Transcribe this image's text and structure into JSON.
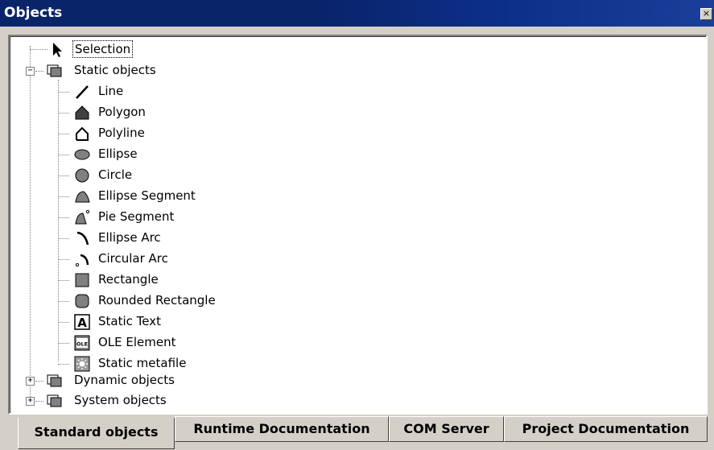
{
  "window": {
    "title": "Objects",
    "close_glyph": "×"
  },
  "tree": {
    "selection": "Selection",
    "static_group": "Static objects",
    "static_items": [
      {
        "label": "Line",
        "icon": "line-icon"
      },
      {
        "label": "Polygon",
        "icon": "polygon-icon"
      },
      {
        "label": "Polyline",
        "icon": "polyline-icon"
      },
      {
        "label": "Ellipse",
        "icon": "ellipse-icon"
      },
      {
        "label": "Circle",
        "icon": "circle-icon"
      },
      {
        "label": "Ellipse Segment",
        "icon": "ellipse-segment-icon"
      },
      {
        "label": "Pie Segment",
        "icon": "pie-segment-icon"
      },
      {
        "label": "Ellipse Arc",
        "icon": "ellipse-arc-icon"
      },
      {
        "label": "Circular Arc",
        "icon": "circular-arc-icon"
      },
      {
        "label": "Rectangle",
        "icon": "rectangle-icon"
      },
      {
        "label": "Rounded Rectangle",
        "icon": "rounded-rectangle-icon"
      },
      {
        "label": "Static Text",
        "icon": "static-text-icon"
      },
      {
        "label": "OLE Element",
        "icon": "ole-element-icon"
      },
      {
        "label": "Static metafile",
        "icon": "static-metafile-icon"
      }
    ],
    "dynamic_group": "Dynamic objects",
    "system_group": "System objects",
    "collapse_glyph": "−",
    "expand_glyph": "+",
    "ole_icon_text": "OLE",
    "text_icon_letter": "A"
  },
  "tabs": [
    {
      "label": "Standard objects",
      "active": true
    },
    {
      "label": "Runtime Documentation",
      "active": false
    },
    {
      "label": "COM Server",
      "active": false
    },
    {
      "label": "Project Documentation",
      "active": false
    }
  ]
}
